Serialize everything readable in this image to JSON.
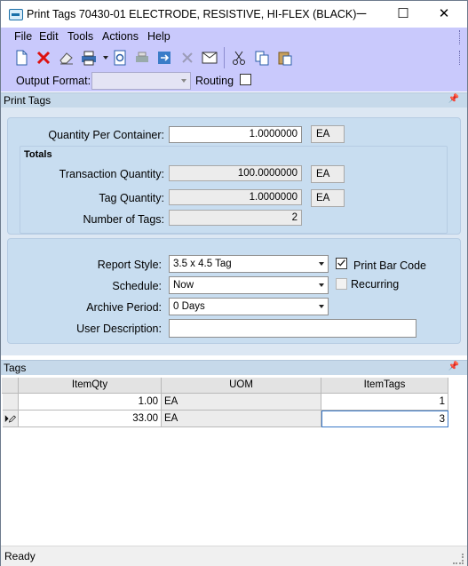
{
  "window": {
    "title": "Print Tags 70430-01 ELECTRODE, RESISTIVE, HI-FLEX (BLACK)",
    "minimize": "─",
    "maximize": "☐",
    "close": "✕"
  },
  "menu": [
    "File",
    "Edit",
    "Tools",
    "Actions",
    "Help"
  ],
  "toolbar_icons": [
    "new-icon",
    "delete-icon",
    "eraser-icon",
    "print-icon",
    "print-dropdown-icon",
    "print-preview-icon",
    "print-setup-icon",
    "refresh-icon",
    "cancel-icon",
    "email-icon",
    "cut-icon",
    "copy-icon",
    "paste-icon"
  ],
  "options_bar": {
    "output_format_label": "Output Format:",
    "output_format_value": "",
    "routing_label": "Routing",
    "routing_checked": false
  },
  "print_tags": {
    "header": "Print Tags",
    "qty_per_container_label": "Quantity Per Container:",
    "qty_per_container": "1.0000000",
    "qty_per_container_uom": "EA",
    "totals_label": "Totals",
    "transaction_qty_label": "Transaction Quantity:",
    "transaction_qty": "100.0000000",
    "transaction_qty_uom": "EA",
    "tag_qty_label": "Tag Quantity:",
    "tag_qty": "1.0000000",
    "tag_qty_uom": "EA",
    "num_tags_label": "Number of Tags:",
    "num_tags": "2",
    "report_style_label": "Report Style:",
    "report_style": "3.5 x 4.5 Tag",
    "print_bar_code_label": "Print Bar Code",
    "print_bar_code_checked": true,
    "schedule_label": "Schedule:",
    "schedule": "Now",
    "recurring_label": "Recurring",
    "recurring_checked": false,
    "archive_period_label": "Archive Period:",
    "archive_period": "0 Days",
    "user_description_label": "User Description:",
    "user_description": ""
  },
  "tags": {
    "header": "Tags",
    "columns": [
      "ItemQty",
      "UOM",
      "ItemTags"
    ],
    "rows": [
      {
        "qty": "1.00",
        "uom": "EA",
        "tags": "1"
      },
      {
        "qty": "33.00",
        "uom": "EA",
        "tags": "3"
      }
    ]
  },
  "status": "Ready",
  "colors": {
    "chrome": "#c9c9fc",
    "panel": "#c8ddf0",
    "header": "#c6d9ea"
  }
}
